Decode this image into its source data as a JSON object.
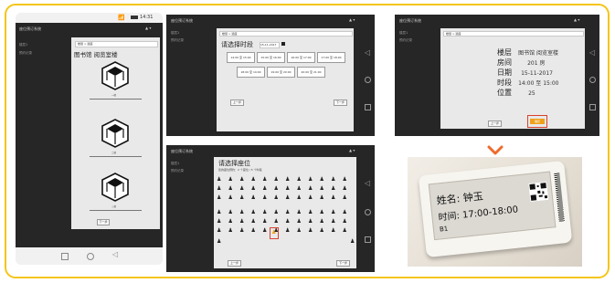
{
  "colors": {
    "frame": "#f5c518",
    "dark": "#262626",
    "accent": "#f0a11b",
    "selection": "#d9412b",
    "arrow": "#ee6b2d"
  },
  "panel1": {
    "status_time": "14:31",
    "app_title": "座位预订系统",
    "side_items": [
      "楼层1",
      "预约记录"
    ],
    "crumb": "楼层 > 选座",
    "heading": "图书馆 阅览室楼",
    "floor_labels": [
      "一楼",
      "二楼",
      "三楼"
    ],
    "next_button": "下一步"
  },
  "panel2": {
    "app_title": "座位预订系统",
    "side_items": [
      "楼层1",
      "预约记录"
    ],
    "crumb": "楼层 > 选座",
    "heading": "请选择时段",
    "date_value": "15-11-2017",
    "slots": [
      "14:00 至 15:00",
      "15:00 至 16:00",
      "16:00 至 17:00",
      "17:00 至 18:00",
      "18:00 至 19:00",
      "19:00 至 20:00",
      "20:00 至 21:00"
    ],
    "prev_button": "上一步",
    "next_button": "下一步"
  },
  "panel3": {
    "app_title": "座位预订系统",
    "side_items": [
      "楼层1",
      "预约记录"
    ],
    "crumb": "楼层 > 选座",
    "rows": [
      {
        "label": "楼层",
        "value": "图书馆 阅览室楼"
      },
      {
        "label": "房间",
        "value": "201 房"
      },
      {
        "label": "日期",
        "value": "15-11-2017"
      },
      {
        "label": "时段",
        "value": "14:00 至 15:00"
      },
      {
        "label": "位置",
        "value": "25"
      }
    ],
    "prev_button": "上一步",
    "confirm_button": "确定"
  },
  "panel4": {
    "app_title": "座位预订系统",
    "side_items": [
      "楼层1",
      "预约记录"
    ],
    "heading": "请选择座位",
    "subheading": "您的座位预约：2 个座位 / 5 个时段",
    "prev_button": "上一步",
    "next_button": "下一步"
  },
  "eink": {
    "name_line": "姓名: 钟玉",
    "time_line": "时间: 17:00-18:00",
    "seat_code": "B1"
  }
}
